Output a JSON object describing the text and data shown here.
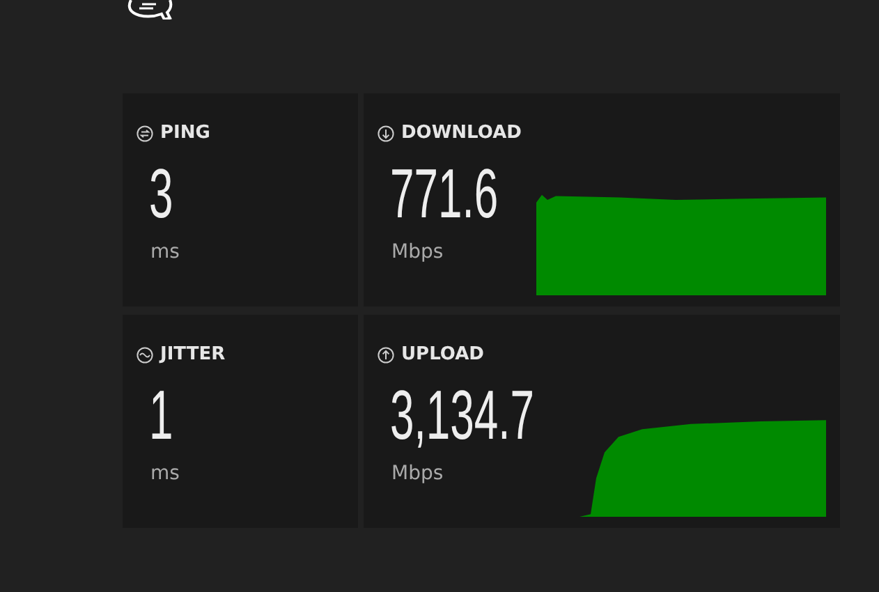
{
  "metrics": [
    {
      "kind": "ping",
      "label": "PING",
      "value": "3",
      "unit": "ms"
    },
    {
      "kind": "download",
      "label": "DOWNLOAD",
      "value": "771.6",
      "unit": "Mbps"
    },
    {
      "kind": "jitter",
      "label": "JITTER",
      "value": "1",
      "unit": "ms"
    },
    {
      "kind": "upload",
      "label": "UPLOAD",
      "value": "3,134.7",
      "unit": "Mbps"
    }
  ]
}
